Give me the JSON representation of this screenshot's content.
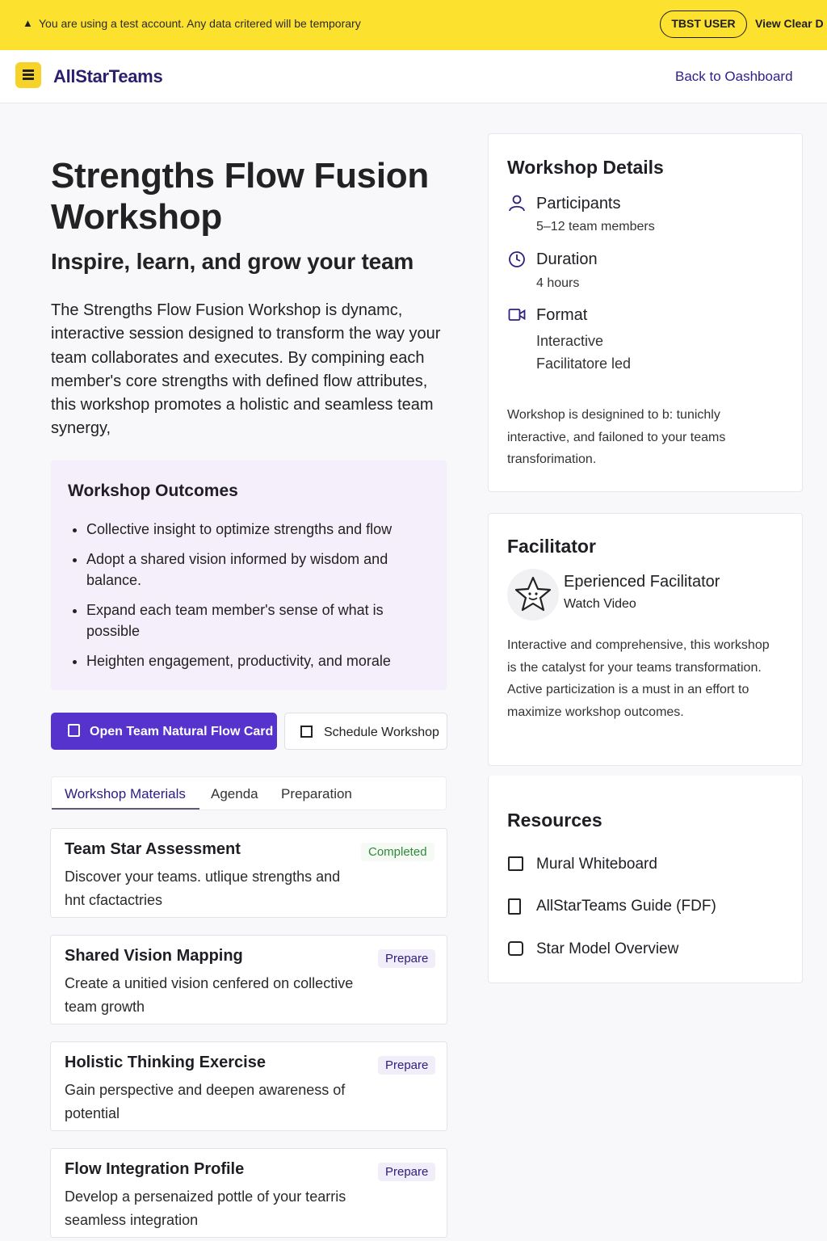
{
  "banner": {
    "message": "You are using a test account. Any data critered will be temporary",
    "user_badge": "TBST USER",
    "view_clear": "View Clear D",
    "warning_icon": "warning-icon"
  },
  "header": {
    "brand": "AllStarTeams",
    "back_link": "Back to Oashboard"
  },
  "hero": {
    "title": "Strengths Flow Fusion Workshop",
    "subtitle": "Inspire, learn, and grow your team",
    "intro": "The Strengths Flow Fusion Workshop is dynamc, interactive session designed to transform the way your team collaborates and executes. By compining each member's core strengths with defined flow attributes, this workshop promotes a holistic and seamless team synergy,"
  },
  "outcomes": {
    "heading": "Workshop Outcomes",
    "items": [
      "Collective insight to optimize strengths and flow",
      "Adopt a shared vision informed by wisdom and balance.",
      "Expand each team member's sense of what is possible",
      "Heighten engagement, productivity, and morale"
    ]
  },
  "actions": {
    "primary": "Open Team Natural Flow Card",
    "secondary": "Schedule Workshop"
  },
  "tabs": {
    "materials": "Workshop Materials",
    "agenda": "Agenda",
    "preparation": "Preparation",
    "active": "Workshop Materials"
  },
  "materials": [
    {
      "title": "Team Star Assessment",
      "description": "Discover your teams. utlique strengths and hnt cfactactries",
      "status": "Completed"
    },
    {
      "title": "Shared Vision Mapping",
      "description": "Create a unitied vision cenfered on collective team growth",
      "status": "Prepare"
    },
    {
      "title": "Holistic Thinking Exercise",
      "description": "Gain perspective and deepen awareness of potential",
      "status": "Prepare"
    },
    {
      "title": "Flow Integration Profile",
      "description": "Develop a persenaized pottle of your tearris seamless integration",
      "status": "Prepare"
    }
  ],
  "details": {
    "heading": "Workshop Details",
    "participants_label": "Participants",
    "participants_value": "5–12 team members",
    "duration_label": "Duration",
    "duration_value": "4 hours",
    "format_label": "Format",
    "format_value_1": "Interactive",
    "format_value_2": "Facilitatore led",
    "note": "Workshop is designined to b: tunichly interactive, and failoned to your teams transforimation."
  },
  "facilitator": {
    "heading": "Facilitator",
    "name": "Eperienced Facilitator",
    "video_link": "Watch Video",
    "description": "Interactive and comprehensive, this workshop is the catalyst for your teams transformation. Active particization is a must in an effort to maximize workshop outcomes."
  },
  "resources": {
    "heading": "Resources",
    "items": [
      {
        "label": "Mural Whiteboard",
        "icon": "whiteboard-icon"
      },
      {
        "label": "AllStarTeams Guide (FDF)",
        "icon": "document-icon"
      },
      {
        "label": "Star Model Overview",
        "icon": "overview-icon"
      }
    ]
  },
  "colors": {
    "banner": "#fde12f",
    "primary": "#5533cc",
    "brand_text": "#2d1e6e",
    "outcomes_bg": "#f5effc",
    "completed": "#2e8a3a"
  }
}
